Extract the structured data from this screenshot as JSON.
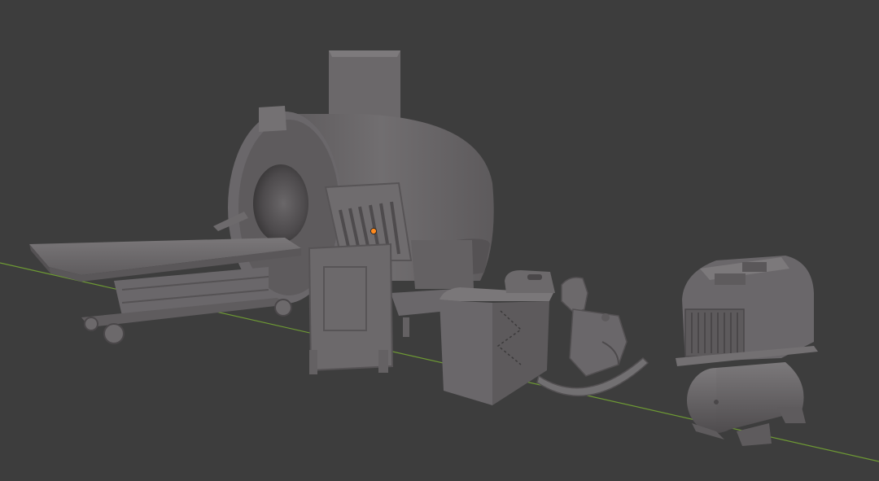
{
  "viewport": {
    "background_color": "#3d3d3d",
    "x_axis_color": "#6e9a34",
    "origin_marker_color": "#ff8a1e",
    "model_color": "#6c696b"
  },
  "scene_objects": [
    {
      "name": "mri-scanner"
    },
    {
      "name": "patient-bed"
    },
    {
      "name": "wooden-chair"
    },
    {
      "name": "side-table"
    },
    {
      "name": "rocking-horse"
    },
    {
      "name": "air-compressor"
    }
  ]
}
